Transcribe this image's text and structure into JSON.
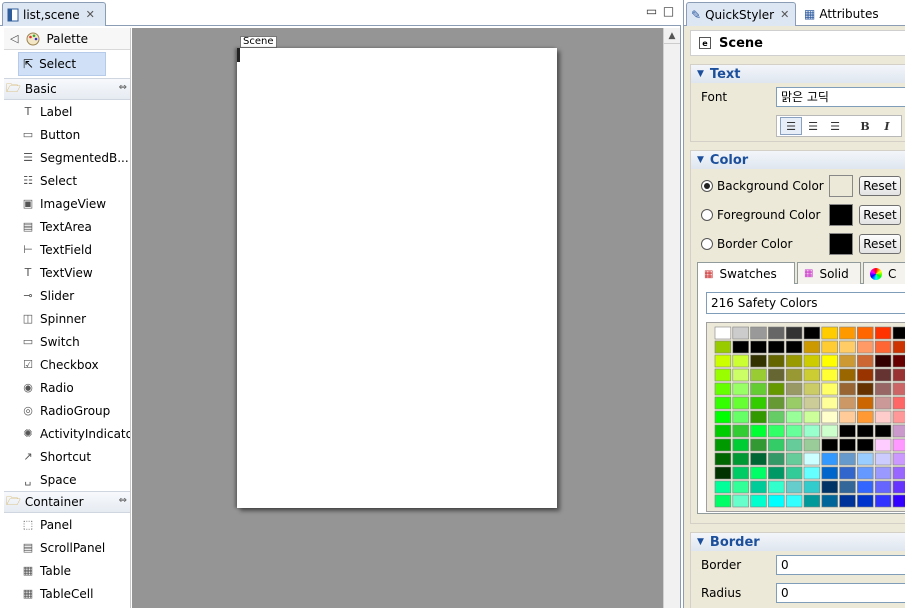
{
  "editor": {
    "tab_label": "list,scene",
    "win_min": "▭",
    "win_max": "□"
  },
  "palette": {
    "title": "Palette",
    "select_label": "Select",
    "sections": [
      {
        "title": "Basic",
        "items": [
          {
            "label": "Label",
            "icon": "label-icon",
            "glyph": "T"
          },
          {
            "label": "Button",
            "icon": "button-icon",
            "glyph": "▭"
          },
          {
            "label": "SegmentedB...",
            "icon": "segmented-button-icon",
            "glyph": "☰"
          },
          {
            "label": "Select",
            "icon": "select-widget-icon",
            "glyph": "☷"
          },
          {
            "label": "ImageView",
            "icon": "image-view-icon",
            "glyph": "▣"
          },
          {
            "label": "TextArea",
            "icon": "text-area-icon",
            "glyph": "▤"
          },
          {
            "label": "TextField",
            "icon": "text-field-icon",
            "glyph": "⊢"
          },
          {
            "label": "TextView",
            "icon": "text-view-icon",
            "glyph": "T"
          },
          {
            "label": "Slider",
            "icon": "slider-icon",
            "glyph": "⊸"
          },
          {
            "label": "Spinner",
            "icon": "spinner-icon",
            "glyph": "◫"
          },
          {
            "label": "Switch",
            "icon": "switch-icon",
            "glyph": "▭"
          },
          {
            "label": "Checkbox",
            "icon": "checkbox-icon",
            "glyph": "☑"
          },
          {
            "label": "Radio",
            "icon": "radio-icon",
            "glyph": "◉"
          },
          {
            "label": "RadioGroup",
            "icon": "radio-group-icon",
            "glyph": "◎"
          },
          {
            "label": "ActivityIndicator",
            "icon": "activity-indicator-icon",
            "glyph": "✺"
          },
          {
            "label": "Shortcut",
            "icon": "shortcut-icon",
            "glyph": "↗"
          },
          {
            "label": "Space",
            "icon": "space-icon",
            "glyph": "␣"
          }
        ]
      },
      {
        "title": "Container",
        "items": [
          {
            "label": "Panel",
            "icon": "panel-icon",
            "glyph": "⬚"
          },
          {
            "label": "ScrollPanel",
            "icon": "scroll-panel-icon",
            "glyph": "▤"
          },
          {
            "label": "Table",
            "icon": "table-icon",
            "glyph": "▦"
          },
          {
            "label": "TableCell",
            "icon": "table-cell-icon",
            "glyph": "▦"
          }
        ]
      }
    ]
  },
  "canvas": {
    "scene_tag": "Scene",
    "background": "#959595"
  },
  "right_panel": {
    "tabs": [
      {
        "label": "QuickStyler",
        "icon": "brush-icon",
        "active": true
      },
      {
        "label": "Attributes",
        "icon": "attributes-icon",
        "active": false
      }
    ],
    "scene_title": "Scene",
    "text_section": {
      "title": "Text",
      "font_label": "Font",
      "font_value": "맑은 고딕",
      "align_buttons": [
        "align-left",
        "align-center",
        "align-right"
      ],
      "bold_label": "B",
      "italic_label": "I"
    },
    "color_section": {
      "title": "Color",
      "rows": [
        {
          "label": "Background Color",
          "selected": true,
          "swatch": "#ece9d8",
          "reset": "Reset"
        },
        {
          "label": "Foreground Color",
          "selected": false,
          "swatch": "#000000",
          "reset": "Reset"
        },
        {
          "label": "Border Color",
          "selected": false,
          "swatch": "#000000",
          "reset": "Reset"
        }
      ],
      "tabs": [
        {
          "label": "Swatches",
          "active": true
        },
        {
          "label": "Solid",
          "active": false
        },
        {
          "label": "C",
          "active": false
        }
      ],
      "palette_combo": "216 Safety Colors",
      "swatch_grid": [
        [
          "#ffffff",
          "#cccccc",
          "#999999",
          "#666666",
          "#333333",
          "#000000",
          "#ffcc00",
          "#ff9900",
          "#ff6600",
          "#ff3300",
          "#000000"
        ],
        [
          "#99cc00",
          "#000000",
          "#000000",
          "#000000",
          "#000000",
          "#cc9900",
          "#ffcc33",
          "#ffcc66",
          "#ff9966",
          "#ff6633",
          "#cc3300"
        ],
        [
          "#ccff00",
          "#ccff33",
          "#333300",
          "#666600",
          "#999900",
          "#cccc00",
          "#ffff00",
          "#cc9933",
          "#cc6633",
          "#330000",
          "#660000"
        ],
        [
          "#99ff00",
          "#ccff66",
          "#99cc33",
          "#666633",
          "#999933",
          "#cccc33",
          "#ffff33",
          "#996600",
          "#993300",
          "#663333",
          "#993333"
        ],
        [
          "#66ff00",
          "#99ff66",
          "#66cc33",
          "#669900",
          "#999966",
          "#cccc66",
          "#ffff66",
          "#996633",
          "#663300",
          "#996666",
          "#cc6666"
        ],
        [
          "#33ff00",
          "#66ff33",
          "#33cc00",
          "#669933",
          "#99cc66",
          "#cccc99",
          "#ffff99",
          "#cc9966",
          "#cc6600",
          "#cc9999",
          "#ff6666"
        ],
        [
          "#00ff00",
          "#66ff66",
          "#339900",
          "#66cc66",
          "#99ff99",
          "#ccff99",
          "#ffffcc",
          "#ffcc99",
          "#ff9933",
          "#ffcccc",
          "#ff9999"
        ],
        [
          "#00cc00",
          "#33cc33",
          "#00ff33",
          "#33ff66",
          "#66ff99",
          "#99ffcc",
          "#ccffcc",
          "#000000",
          "#000000",
          "#000000",
          "#cc99cc"
        ],
        [
          "#009900",
          "#00cc33",
          "#339933",
          "#33cc66",
          "#66cc99",
          "#99cc99",
          "#000000",
          "#000000",
          "#000000",
          "#ffccff",
          "#ff99ff"
        ],
        [
          "#006600",
          "#009933",
          "#006633",
          "#339966",
          "#66cc99",
          "#ccffff",
          "#3399ff",
          "#6699cc",
          "#99ccff",
          "#ccccff",
          "#cc99ff"
        ],
        [
          "#003300",
          "#00cc66",
          "#00ff66",
          "#009966",
          "#33cc99",
          "#66ffff",
          "#0066cc",
          "#3366cc",
          "#6699ff",
          "#9999ff",
          "#9966ff"
        ],
        [
          "#00ff99",
          "#33ff99",
          "#00cc99",
          "#33ffcc",
          "#66cccc",
          "#33cccc",
          "#003366",
          "#336699",
          "#3366ff",
          "#6666ff",
          "#6633ff"
        ],
        [
          "#00ff66",
          "#66ffcc",
          "#00ffcc",
          "#00ffff",
          "#33ffff",
          "#009999",
          "#006699",
          "#003399",
          "#0033cc",
          "#3333ff",
          "#3300ff"
        ]
      ]
    },
    "border_section": {
      "title": "Border",
      "border_label": "Border",
      "border_value": "0",
      "radius_label": "Radius",
      "radius_value": "0"
    }
  }
}
